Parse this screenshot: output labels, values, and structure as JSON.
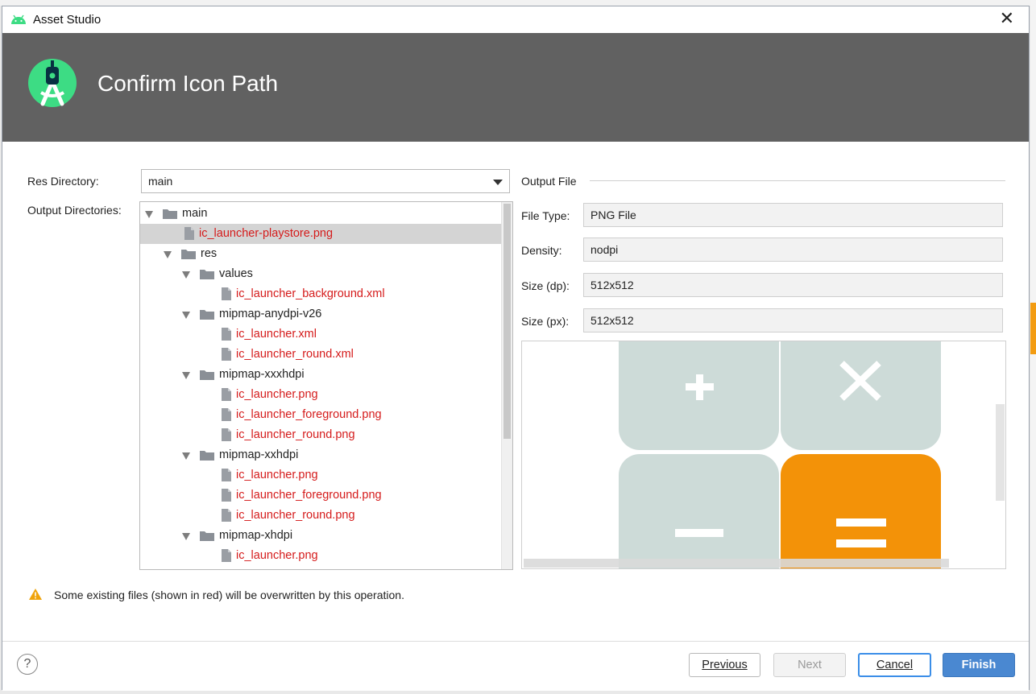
{
  "window": {
    "title": "Asset Studio"
  },
  "header": {
    "title": "Confirm Icon Path"
  },
  "form": {
    "res_directory_label": "Res Directory:",
    "res_directory_value": "main",
    "output_directories_label": "Output Directories:"
  },
  "tree": [
    {
      "name": "main",
      "type": "folder",
      "expanded": true,
      "red": false,
      "depth": 0
    },
    {
      "name": "ic_launcher-playstore.png",
      "type": "file",
      "red": true,
      "depth": 1,
      "selected": true
    },
    {
      "name": "res",
      "type": "folder",
      "expanded": true,
      "red": false,
      "depth": 1
    },
    {
      "name": "values",
      "type": "folder",
      "expanded": true,
      "red": false,
      "depth": 2
    },
    {
      "name": "ic_launcher_background.xml",
      "type": "file",
      "red": true,
      "depth": 3
    },
    {
      "name": "mipmap-anydpi-v26",
      "type": "folder",
      "expanded": true,
      "red": false,
      "depth": 2
    },
    {
      "name": "ic_launcher.xml",
      "type": "file",
      "red": true,
      "depth": 3
    },
    {
      "name": "ic_launcher_round.xml",
      "type": "file",
      "red": true,
      "depth": 3
    },
    {
      "name": "mipmap-xxxhdpi",
      "type": "folder",
      "expanded": true,
      "red": false,
      "depth": 2
    },
    {
      "name": "ic_launcher.png",
      "type": "file",
      "red": true,
      "depth": 3
    },
    {
      "name": "ic_launcher_foreground.png",
      "type": "file",
      "red": true,
      "depth": 3
    },
    {
      "name": "ic_launcher_round.png",
      "type": "file",
      "red": true,
      "depth": 3
    },
    {
      "name": "mipmap-xxhdpi",
      "type": "folder",
      "expanded": true,
      "red": false,
      "depth": 2
    },
    {
      "name": "ic_launcher.png",
      "type": "file",
      "red": true,
      "depth": 3
    },
    {
      "name": "ic_launcher_foreground.png",
      "type": "file",
      "red": true,
      "depth": 3
    },
    {
      "name": "ic_launcher_round.png",
      "type": "file",
      "red": true,
      "depth": 3
    },
    {
      "name": "mipmap-xhdpi",
      "type": "folder",
      "expanded": true,
      "red": false,
      "depth": 2
    },
    {
      "name": "ic_launcher.png",
      "type": "file",
      "red": true,
      "depth": 3
    }
  ],
  "output_file": {
    "section_title": "Output File",
    "file_type_label": "File Type:",
    "file_type_value": "PNG File",
    "density_label": "Density:",
    "density_value": "nodpi",
    "size_dp_label": "Size (dp):",
    "size_dp_value": "512x512",
    "size_px_label": "Size (px):",
    "size_px_value": "512x512"
  },
  "preview": {
    "tile_color": "#cddbd8",
    "accent_color": "#f39208",
    "symbols": [
      "+",
      "×",
      "−",
      "="
    ]
  },
  "warning": {
    "icon": "warning-icon",
    "text": "Some existing files (shown in red) will be overwritten by this operation."
  },
  "buttons": {
    "help": "?",
    "previous": "Previous",
    "next": "Next",
    "cancel": "Cancel",
    "finish": "Finish"
  },
  "colors": {
    "header_bg": "#616161",
    "red_file": "#d51b1b",
    "primary_button": "#4a88d1"
  }
}
